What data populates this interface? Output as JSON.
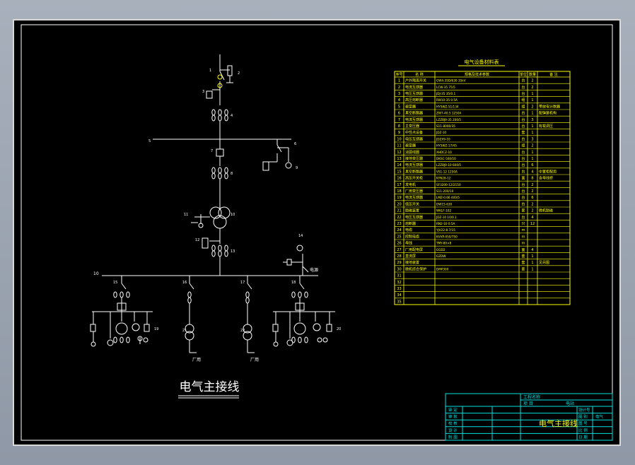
{
  "drawing": {
    "title": "电气主接线",
    "table_title": "电气设备材料表",
    "table_headers": [
      "序号",
      "名 称",
      "规格及技术参数",
      "单位",
      "数量",
      "备 注"
    ],
    "table_rows": [
      {
        "no": "1",
        "name": "户外隔离开关",
        "spec": "GW4-35D/630 35kV",
        "unit": "台",
        "qty": "2",
        "note": ""
      },
      {
        "no": "2",
        "name": "电流互感器",
        "spec": "LCW-35 75/5",
        "unit": "台",
        "qty": "2",
        "note": ""
      },
      {
        "no": "3",
        "name": "电压互感器",
        "spec": "JDJ-35 35/0.1",
        "unit": "台",
        "qty": "1",
        "note": ""
      },
      {
        "no": "4",
        "name": "高压熔断器",
        "spec": "RW10-35 0.5A",
        "unit": "组",
        "qty": "1",
        "note": ""
      },
      {
        "no": "5",
        "name": "避雷器",
        "spec": "HY5WZ-51/134",
        "unit": "组",
        "qty": "2",
        "note": "带放电计数器"
      },
      {
        "no": "6",
        "name": "真空断路器",
        "spec": "ZW7-40.5 1250A",
        "unit": "台",
        "qty": "1",
        "note": "配弹簧机构"
      },
      {
        "no": "7",
        "name": "电流互感器",
        "spec": "LZZBJ9-35 200/5",
        "unit": "台",
        "qty": "3",
        "note": ""
      },
      {
        "no": "8",
        "name": "主变压器",
        "spec": "S11-8000/35",
        "unit": "台",
        "qty": "1",
        "note": "有载调压"
      },
      {
        "no": "9",
        "name": "中性点设备",
        "spec": "JDZ-10",
        "unit": "套",
        "qty": "1",
        "note": ""
      },
      {
        "no": "10",
        "name": "电压互感器",
        "spec": "JDZX9-10",
        "unit": "台",
        "qty": "3",
        "note": ""
      },
      {
        "no": "11",
        "name": "避雷器",
        "spec": "HY5WZ-17/45",
        "unit": "组",
        "qty": "2",
        "note": ""
      },
      {
        "no": "12",
        "name": "消弧线圈",
        "spec": "XHDCZ-10",
        "unit": "台",
        "qty": "1",
        "note": ""
      },
      {
        "no": "13",
        "name": "接地变压器",
        "spec": "DKSC-500/10",
        "unit": "台",
        "qty": "1",
        "note": ""
      },
      {
        "no": "14",
        "name": "电流互感器",
        "spec": "LZZBJ9-10 600/5",
        "unit": "台",
        "qty": "6",
        "note": ""
      },
      {
        "no": "15",
        "name": "真空断路器",
        "spec": "VS1-12 1250A",
        "unit": "台",
        "qty": "4",
        "note": "中置柜配用"
      },
      {
        "no": "16",
        "name": "高压开关柜",
        "spec": "KYN28-12",
        "unit": "面",
        "qty": "8",
        "note": "含母线桥"
      },
      {
        "no": "17",
        "name": "发电机",
        "spec": "SF3200-12/2150",
        "unit": "台",
        "qty": "2",
        "note": ""
      },
      {
        "no": "18",
        "name": "厂用变压器",
        "spec": "S11-200/10",
        "unit": "台",
        "qty": "2",
        "note": ""
      },
      {
        "no": "19",
        "name": "电流互感器",
        "spec": "LMZ-0.66 400/5",
        "unit": "台",
        "qty": "6",
        "note": ""
      },
      {
        "no": "20",
        "name": "低压开关",
        "spec": "DW15-630",
        "unit": "台",
        "qty": "2",
        "note": ""
      },
      {
        "no": "21",
        "name": "励磁装置",
        "spec": "WKLF-102",
        "unit": "套",
        "qty": "2",
        "note": "微机励磁"
      },
      {
        "no": "22",
        "name": "电压互感器",
        "spec": "JDZ-10 10/0.1",
        "unit": "台",
        "qty": "4",
        "note": ""
      },
      {
        "no": "23",
        "name": "熔断器",
        "spec": "RN2-10 0.5A",
        "unit": "只",
        "qty": "12",
        "note": ""
      },
      {
        "no": "24",
        "name": "电缆",
        "spec": "YJV22-8.7/15",
        "unit": "m",
        "qty": "",
        "note": ""
      },
      {
        "no": "25",
        "name": "控制电缆",
        "spec": "KVVP-450/750",
        "unit": "m",
        "qty": "",
        "note": ""
      },
      {
        "no": "26",
        "name": "母线",
        "spec": "TMY-80×8",
        "unit": "m",
        "qty": "",
        "note": ""
      },
      {
        "no": "27",
        "name": "厂用配电屏",
        "spec": "GGD2",
        "unit": "面",
        "qty": "4",
        "note": ""
      },
      {
        "no": "28",
        "name": "直流屏",
        "spec": "GZDW",
        "unit": "套",
        "qty": "1",
        "note": ""
      },
      {
        "no": "29",
        "name": "接地装置",
        "spec": "",
        "unit": "套",
        "qty": "1",
        "note": "见另图"
      },
      {
        "no": "30",
        "name": "微机综合保护",
        "spec": "DMP300",
        "unit": "套",
        "qty": "1",
        "note": ""
      },
      {
        "no": "31",
        "name": "",
        "spec": "",
        "unit": "",
        "qty": "",
        "note": ""
      },
      {
        "no": "32",
        "name": "",
        "spec": "",
        "unit": "",
        "qty": "",
        "note": ""
      },
      {
        "no": "33",
        "name": "",
        "spec": "",
        "unit": "",
        "qty": "",
        "note": ""
      },
      {
        "no": "34",
        "name": "",
        "spec": "",
        "unit": "",
        "qty": "",
        "note": ""
      },
      {
        "no": "35",
        "name": "",
        "spec": "",
        "unit": "",
        "qty": "",
        "note": ""
      }
    ],
    "title_block": {
      "project_label": "工程名称",
      "item_label": "项 目",
      "item_value": "电站",
      "drawing_title": "电气主接线",
      "left_labels": [
        "审 定",
        "审 核",
        "校 核",
        "设 计",
        "制 图"
      ],
      "right_labels": [
        "设计号",
        "图 别",
        "图 号",
        "比 例",
        "日 期"
      ],
      "right_values": [
        "",
        "电气",
        "",
        "",
        ""
      ]
    },
    "bus_left_label": "10",
    "bus_right_label": "电源",
    "feeder_labels": [
      "厂用",
      "厂用"
    ],
    "ref_numbers": [
      "1",
      "2",
      "3",
      "4",
      "5",
      "6",
      "7",
      "8",
      "9",
      "10",
      "11",
      "12",
      "13",
      "14",
      "15",
      "16",
      "17",
      "18",
      "19",
      "20",
      "21",
      "22"
    ]
  },
  "colors": {
    "background": "#000000",
    "line": "#ffffff",
    "table": "#ffff00",
    "title_block": "#00e0e0"
  }
}
